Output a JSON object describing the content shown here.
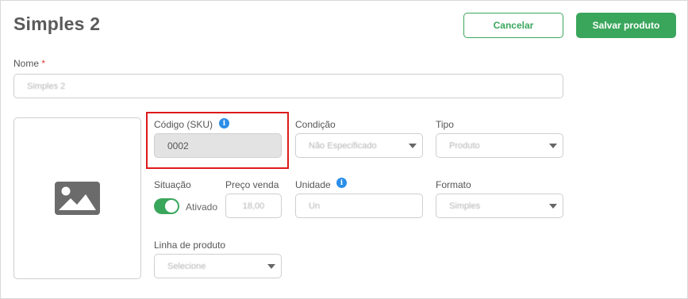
{
  "header": {
    "title": "Simples 2",
    "cancel_label": "Cancelar",
    "save_label": "Salvar produto"
  },
  "form": {
    "nome": {
      "label": "Nome",
      "required_mark": "*",
      "value": "Simples 2"
    },
    "codigo": {
      "label": "Código (SKU)",
      "value": "0002",
      "info_icon": "info-icon"
    },
    "condicao": {
      "label": "Condição",
      "value": "Não Especificado"
    },
    "tipo": {
      "label": "Tipo",
      "value": "Produto"
    },
    "situacao": {
      "label": "Situação",
      "toggle_label": "Ativado",
      "enabled": true
    },
    "preco": {
      "label": "Preço venda",
      "value": "18,00"
    },
    "unidade": {
      "label": "Unidade",
      "placeholder": "Un",
      "info_icon": "info-icon"
    },
    "formato": {
      "label": "Formato",
      "value": "Simples"
    },
    "linha": {
      "label": "Linha de produto",
      "value": "Selecione"
    }
  },
  "colors": {
    "accent": "#3aa65c",
    "highlight": "#dd1a1a",
    "info": "#2a8ee8"
  },
  "image_placeholder_icon": "image-icon"
}
